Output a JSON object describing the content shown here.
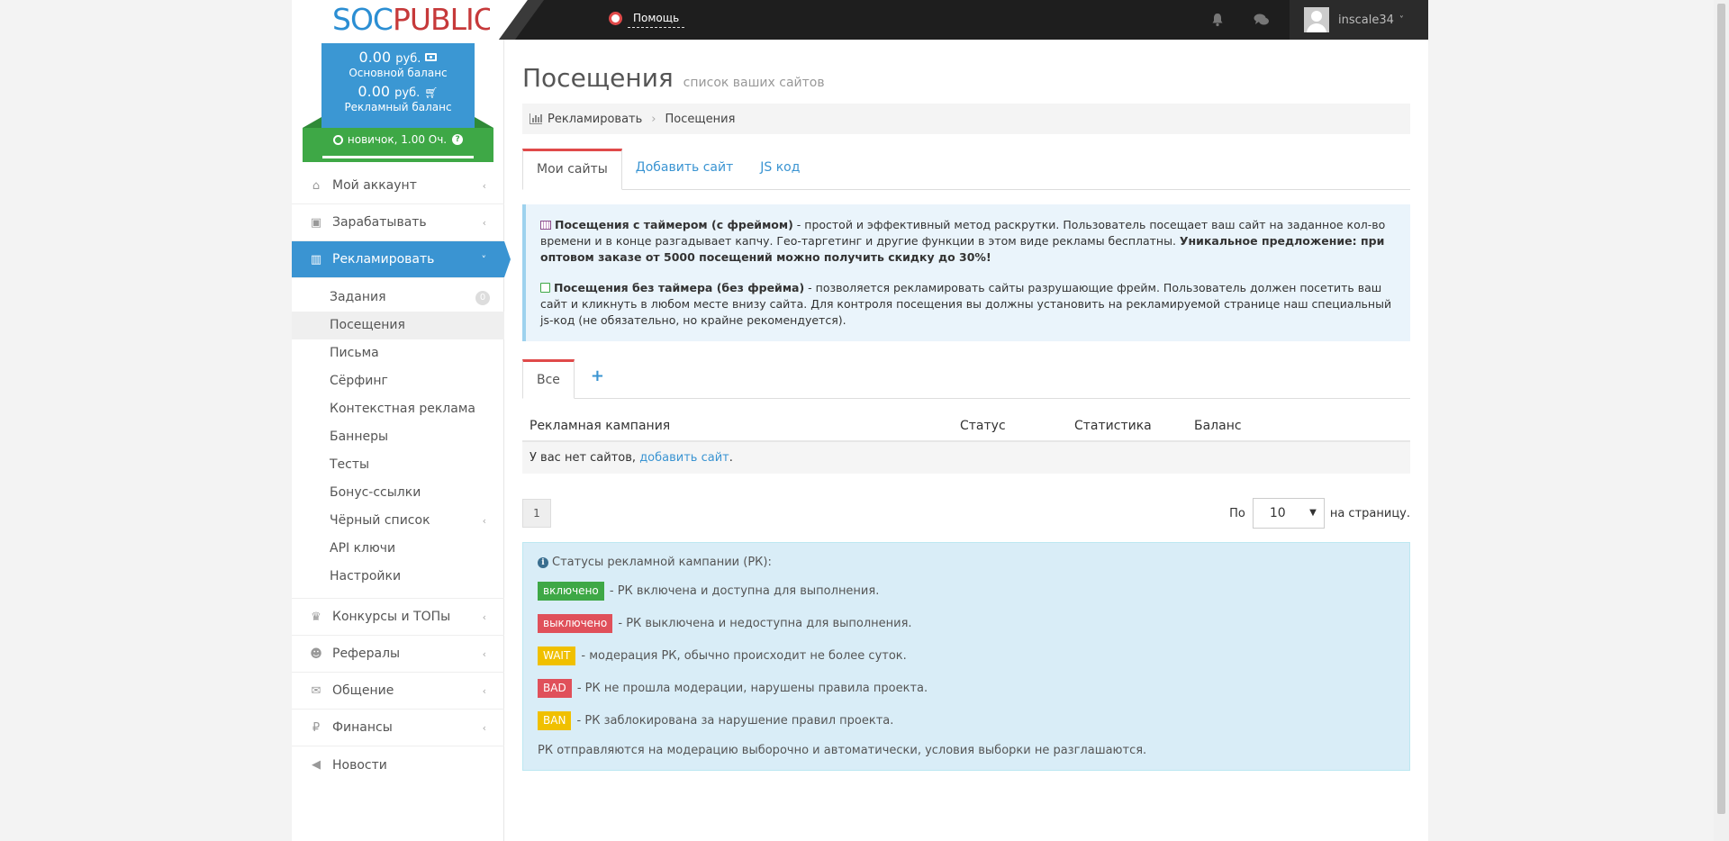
{
  "logo": {
    "part1": "SOC",
    "part2": "PUBLIC"
  },
  "header": {
    "help_label": "Помощь",
    "username": "inscale34",
    "caret": "˅"
  },
  "balance": {
    "main_amount": "0.00",
    "main_currency": "руб.",
    "main_label": "Основной баланс",
    "ad_amount": "0.00",
    "ad_currency": "руб.",
    "ad_label": "Рекламный баланс",
    "level_text": "новичок, 1.00 Оч.",
    "level_help": "?"
  },
  "sidebar": {
    "items": [
      {
        "label": "Мой аккаунт",
        "icon": "home-icon",
        "glyph": "⌂",
        "arrow": "‹"
      },
      {
        "label": "Зарабатывать",
        "icon": "briefcase-icon",
        "glyph": "▣",
        "arrow": "‹"
      },
      {
        "label": "Рекламировать",
        "icon": "bar-chart-icon",
        "glyph": "▥",
        "arrow": "˅"
      }
    ],
    "submenu": [
      {
        "label": "Задания",
        "badge": "0"
      },
      {
        "label": "Посещения"
      },
      {
        "label": "Письма"
      },
      {
        "label": "Сёрфинг"
      },
      {
        "label": "Контекстная реклама"
      },
      {
        "label": "Баннеры"
      },
      {
        "label": "Тесты"
      },
      {
        "label": "Бонус-ссылки"
      },
      {
        "label": "Чёрный список",
        "arrow": "‹"
      },
      {
        "label": "API ключи"
      },
      {
        "label": "Настройки"
      }
    ],
    "items_after": [
      {
        "label": "Конкурсы и ТОПы",
        "icon": "trophy-icon",
        "glyph": "♛",
        "arrow": "‹"
      },
      {
        "label": "Рефералы",
        "icon": "users-icon",
        "glyph": "☻",
        "arrow": "‹"
      },
      {
        "label": "Общение",
        "icon": "comments-icon",
        "glyph": "✉",
        "arrow": "‹"
      },
      {
        "label": "Финансы",
        "icon": "ruble-icon",
        "glyph": "₽",
        "arrow": "‹"
      },
      {
        "label": "Новости",
        "icon": "bullhorn-icon",
        "glyph": "◀",
        "arrow": ""
      }
    ]
  },
  "main": {
    "title": "Посещения",
    "subtitle": "список ваших сайтов",
    "breadcrumb": [
      "Рекламировать",
      "Посещения"
    ],
    "breadcrumb_sep": "›",
    "tabs": [
      "Мои сайты",
      "Добавить сайт",
      "JS код"
    ],
    "info": {
      "p1_bold": "Посещения с таймером (с фреймом)",
      "p1_text": " - простой и эффективный метод раскрутки. Пользователь посещает ваш сайт на заданное кол-во времени и в конце разгадывает капчу. Гео-таргетинг и другие функции в этом виде рекламы бесплатны. ",
      "p1_bold2": "Уникальное предложение: при оптовом заказе от 5000 посещений можно получить скидку до 30%!",
      "p2_bold": "Посещения без таймера (без фрейма)",
      "p2_text": " - позволяется рекламировать сайты разрушающие фрейм. Пользователь должен посетить ваш сайт и кликнуть в любом месте внизу сайта. Для контроля посещения вы должны установить на рекламируемой странице наш специальный js-код (не обязательно, но крайне рекомендуется)."
    },
    "subtabs": {
      "all": "Все",
      "add": "+"
    },
    "table": {
      "headers": [
        "Рекламная кампания",
        "Статус",
        "Статистика",
        "Баланс"
      ],
      "empty_text": "У вас нет сайтов, ",
      "empty_link": "добавить сайт",
      "empty_end": "."
    },
    "pager": {
      "page": "1",
      "per_page_prefix": "По",
      "per_page_value": "10",
      "per_page_arrow": "▼",
      "per_page_suffix": "на страницу."
    },
    "statuses": {
      "heading": "Статусы рекламной кампании (РК):",
      "info_icon": "i",
      "rows": [
        {
          "label": "включено",
          "color": "#3ea846",
          "text": " - РК включена и доступна для выполнения."
        },
        {
          "label": "выключено",
          "color": "#e0505a",
          "text": " - РК выключена и недоступна для выполнения."
        },
        {
          "label": "WAIT",
          "color": "#f0c000",
          "text": " - модерация РК, обычно происходит не более суток."
        },
        {
          "label": "BAD",
          "color": "#e0505a",
          "text": " - РК не прошла модерации, нарушены правила проекта."
        },
        {
          "label": "BAN",
          "color": "#f0c000",
          "text": " - РК заблокирована за нарушение правил проекта."
        }
      ],
      "footer": "РК отправляются на модерацию выборочно и автоматически, условия выборки не разглашаются."
    }
  }
}
